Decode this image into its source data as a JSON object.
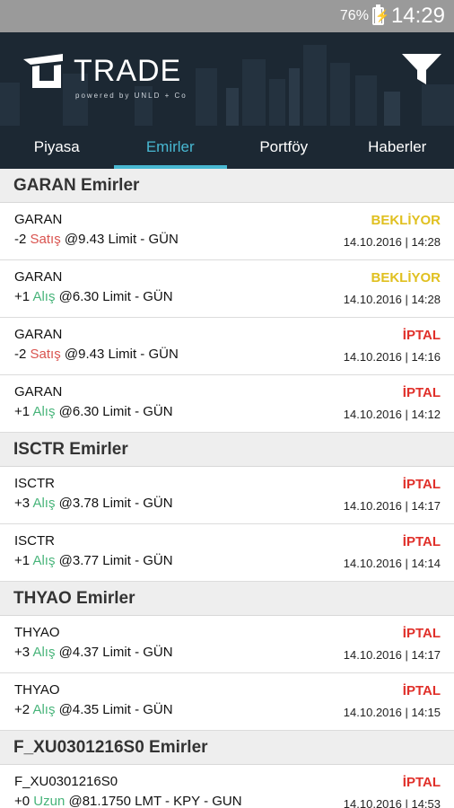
{
  "status_bar": {
    "battery": "76%",
    "time": "14:29"
  },
  "header": {
    "logo_text": "TRADE",
    "logo_sub": "powered by UNLD + Co"
  },
  "tabs": [
    {
      "label": "Piyasa",
      "active": false
    },
    {
      "label": "Emirler",
      "active": true
    },
    {
      "label": "Portföy",
      "active": false
    },
    {
      "label": "Haberler",
      "active": false
    }
  ],
  "groups": [
    {
      "title": "GARAN Emirler",
      "orders": [
        {
          "symbol": "GARAN",
          "qty": "-2",
          "side": "Satış",
          "side_type": "sell",
          "price": "@9.43",
          "type": "Limit - GÜN",
          "status": "BEKLİYOR",
          "status_type": "pending",
          "time": "14.10.2016 | 14:28"
        },
        {
          "symbol": "GARAN",
          "qty": "+1",
          "side": "Alış",
          "side_type": "buy",
          "price": "@6.30",
          "type": "Limit - GÜN",
          "status": "BEKLİYOR",
          "status_type": "pending",
          "time": "14.10.2016 | 14:28"
        },
        {
          "symbol": "GARAN",
          "qty": "-2",
          "side": "Satış",
          "side_type": "sell",
          "price": "@9.43",
          "type": "Limit - GÜN",
          "status": "İPTAL",
          "status_type": "cancel",
          "time": "14.10.2016 | 14:16"
        },
        {
          "symbol": "GARAN",
          "qty": "+1",
          "side": "Alış",
          "side_type": "buy",
          "price": "@6.30",
          "type": "Limit - GÜN",
          "status": "İPTAL",
          "status_type": "cancel",
          "time": "14.10.2016 | 14:12"
        }
      ]
    },
    {
      "title": "ISCTR Emirler",
      "orders": [
        {
          "symbol": "ISCTR",
          "qty": "+3",
          "side": "Alış",
          "side_type": "buy",
          "price": "@3.78",
          "type": "Limit - GÜN",
          "status": "İPTAL",
          "status_type": "cancel",
          "time": "14.10.2016 | 14:17"
        },
        {
          "symbol": "ISCTR",
          "qty": "+1",
          "side": "Alış",
          "side_type": "buy",
          "price": "@3.77",
          "type": "Limit - GÜN",
          "status": "İPTAL",
          "status_type": "cancel",
          "time": "14.10.2016 | 14:14"
        }
      ]
    },
    {
      "title": "THYAO Emirler",
      "orders": [
        {
          "symbol": "THYAO",
          "qty": "+3",
          "side": "Alış",
          "side_type": "buy",
          "price": "@4.37",
          "type": "Limit - GÜN",
          "status": "İPTAL",
          "status_type": "cancel",
          "time": "14.10.2016 | 14:17"
        },
        {
          "symbol": "THYAO",
          "qty": "+2",
          "side": "Alış",
          "side_type": "buy",
          "price": "@4.35",
          "type": "Limit - GÜN",
          "status": "İPTAL",
          "status_type": "cancel",
          "time": "14.10.2016 | 14:15"
        }
      ]
    },
    {
      "title": "F_XU0301216S0 Emirler",
      "orders": [
        {
          "symbol": "F_XU0301216S0",
          "qty": "+0",
          "side": "Uzun",
          "side_type": "buy",
          "price": "@81.1750",
          "type": "LMT - KPY - GUN",
          "status": "İPTAL",
          "status_type": "cancel",
          "time": "14.10.2016 | 14:53"
        }
      ]
    }
  ],
  "icons": {
    "filter": "filter-icon",
    "battery": "battery-charging-icon"
  },
  "colors": {
    "accent": "#48b8d2",
    "sell": "#d9534f",
    "buy": "#48b47a",
    "pending": "#e0c020",
    "cancel": "#e0302a",
    "header_bg": "#1c2833"
  }
}
